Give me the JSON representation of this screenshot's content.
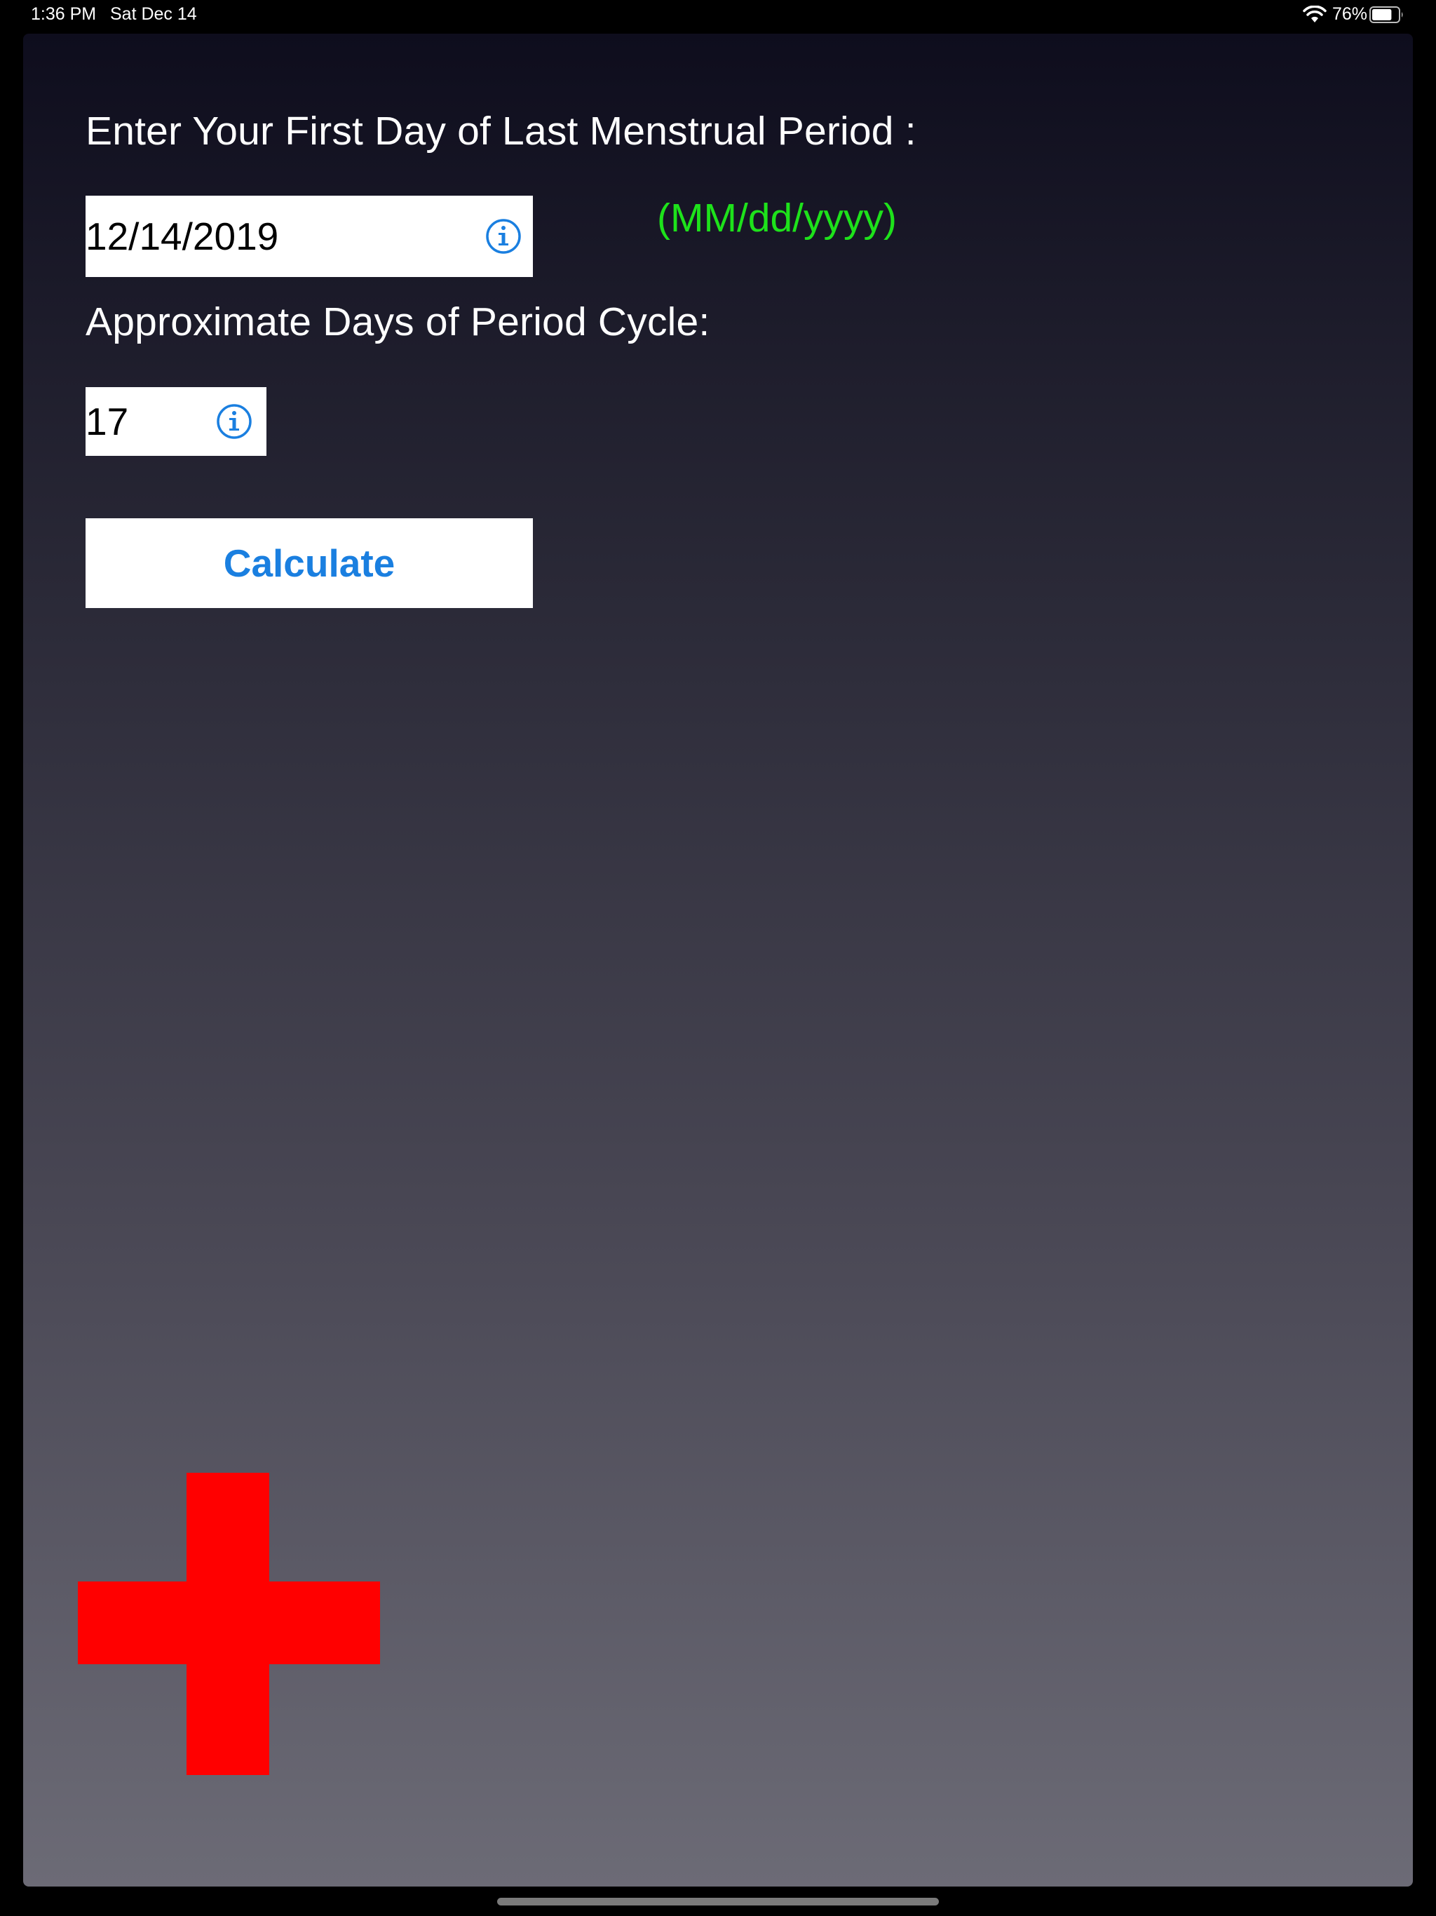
{
  "status_bar": {
    "time": "1:36 PM",
    "date": "Sat Dec 14",
    "battery_percent": "76%",
    "battery_level": 0.76,
    "wifi_icon": "wifi-icon",
    "battery_icon": "battery-icon"
  },
  "form": {
    "lmp_label": "Enter Your First Day of Last Menstrual Period :",
    "lmp_value": "12/14/2019",
    "date_format_hint": "(MM/dd/yyyy)",
    "cycle_label": "Approximate Days of Period Cycle:",
    "cycle_value": "17",
    "info_icon": "info-icon",
    "calculate_label": "Calculate"
  },
  "decor": {
    "cross_icon": "red-cross-icon"
  },
  "colors": {
    "hint_green": "#1ee21b",
    "accent_blue": "#1a7fe0",
    "cross_red": "#ff0000",
    "text_white": "#ffffff"
  }
}
